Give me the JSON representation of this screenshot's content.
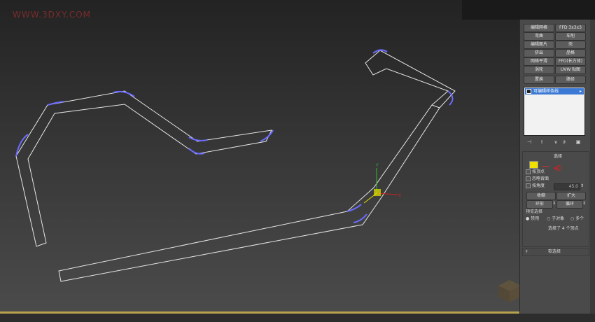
{
  "watermark": "WWW.3DXY.COM",
  "buttons": [
    "编辑网格",
    "FFD 3x3x3",
    "弯曲",
    "车削",
    "编辑面片",
    "壳",
    "挤出",
    "晶格",
    "网格平滑",
    "FFD(长方体)",
    "涡轮",
    "UVW 贴图",
    "置换",
    "路径"
  ],
  "modifier_stack": {
    "item": "可编辑样条线",
    "arrow": "▸"
  },
  "stack_tools": [
    "⊣",
    "Ⅰ",
    "∨",
    "∂",
    "▣"
  ],
  "selection": {
    "title": "选择",
    "by_vertex": "按顶点",
    "ignore_backface": "忽略背面",
    "by_angle": "按角度",
    "angle_value": "45.0",
    "shrink": "收缩",
    "grow": "扩大",
    "ring": "环形",
    "loop": "循环",
    "preview_title": "预览选择",
    "preview_options": [
      "禁用",
      "子对象",
      "多个"
    ],
    "status": "选择了 4 个顶点"
  },
  "soft_selection": {
    "title": "软选择",
    "toggle": "+"
  },
  "colors": {
    "spline": "#e6e6e6",
    "selected_segment": "#6b6bff",
    "axis_x": "#cc2222",
    "axis_y": "#33bb33",
    "axis_z": "#dddd00",
    "accent_yellow": "#f0e000"
  }
}
